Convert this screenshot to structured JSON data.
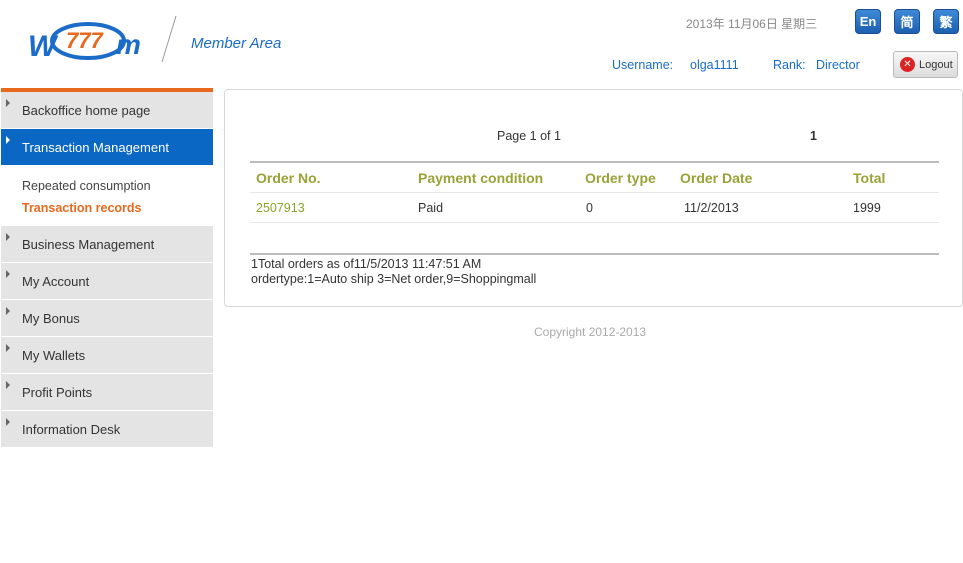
{
  "header": {
    "logo_text": "777",
    "member_area": "Member Area",
    "date": "2013年 11月06日   星期三",
    "languages": [
      "En",
      "简",
      "繁"
    ],
    "username_label": "Username:",
    "username_value": "olga1111",
    "rank_label": "Rank:",
    "rank_value": "Director",
    "logout_label": "Logout"
  },
  "sidebar": {
    "items": [
      {
        "label": "Backoffice home page"
      },
      {
        "label": "Transaction Management"
      },
      {
        "label": "Business Management"
      },
      {
        "label": "My Account"
      },
      {
        "label": "My Bonus"
      },
      {
        "label": "My Wallets"
      },
      {
        "label": "Profit Points"
      },
      {
        "label": "Information Desk"
      }
    ],
    "sub_items": [
      {
        "label": "Repeated consumption"
      },
      {
        "label": "Transaction records"
      }
    ]
  },
  "main": {
    "pager_text": "Page 1 of 1",
    "pager_current": "1",
    "columns": [
      "Order No.",
      "Payment condition",
      "Order type",
      "Order Date",
      "Total"
    ],
    "rows": [
      {
        "order_no": "2507913",
        "payment": "Paid",
        "type": "0",
        "date": "11/2/2013",
        "total": "1999"
      }
    ],
    "summary": "1Total orders as of11/5/2013  11:47:51 AM",
    "legend": "ordertype:1=Auto ship 3=Net order,9=Shoppingmall"
  },
  "footer": {
    "copyright": "Copyright 2012-2013"
  },
  "colors": {
    "accent_blue": "#0b67c4",
    "accent_orange": "#e8691e",
    "header_olive": "#9aa237"
  }
}
